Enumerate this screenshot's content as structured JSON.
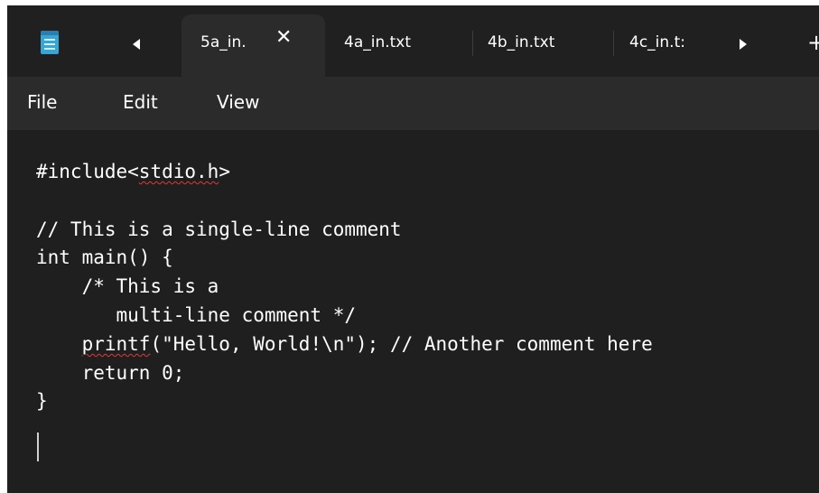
{
  "tabs": {
    "active": {
      "label": "5a_in.",
      "close_glyph": "✕"
    },
    "items": [
      {
        "label": "4a_in.txt"
      },
      {
        "label": "4b_in.txt"
      },
      {
        "label": "4c_in.t:"
      }
    ],
    "scroll_left_icon": "triangle-left",
    "scroll_right_icon": "triangle-right",
    "new_tab_glyph": "+"
  },
  "menu": {
    "file": "File",
    "edit": "Edit",
    "view": "View"
  },
  "editor": {
    "lines": [
      {
        "pre": "#include<",
        "squig": "stdio.h",
        "post": ">"
      },
      {
        "pre": "",
        "squig": "",
        "post": ""
      },
      {
        "pre": "// This is a single-line comment",
        "squig": "",
        "post": ""
      },
      {
        "pre": "int main() {",
        "squig": "",
        "post": ""
      },
      {
        "pre": "    /* This is a",
        "squig": "",
        "post": ""
      },
      {
        "pre": "       multi-line comment */",
        "squig": "",
        "post": ""
      },
      {
        "pre": "    ",
        "squig": "printf",
        "post": "(\"Hello, World!\\n\"); // Another comment here"
      },
      {
        "pre": "    return 0;",
        "squig": "",
        "post": ""
      },
      {
        "pre": "}",
        "squig": "",
        "post": ""
      }
    ]
  },
  "colors": {
    "background": "#1f1f1f",
    "active_tab": "#2b2b2b",
    "text": "#ffffff",
    "spellcheck": "#e23838"
  }
}
